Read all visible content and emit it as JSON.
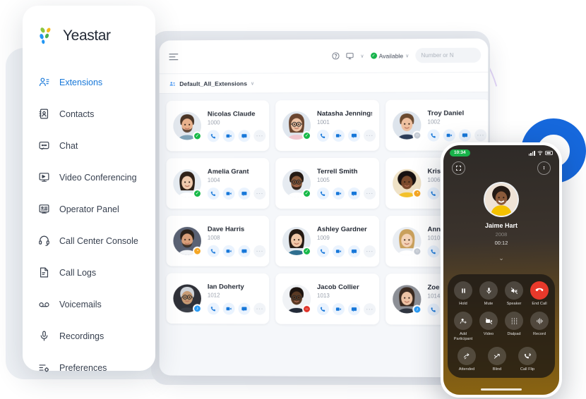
{
  "brand": {
    "name": "Yeastar",
    "accent": "#1677d9",
    "logo_icon": "yeastar-logo"
  },
  "sidebar": {
    "items": [
      {
        "label": "Extensions",
        "icon": "extensions-icon",
        "active": true
      },
      {
        "label": "Contacts",
        "icon": "contacts-icon",
        "active": false
      },
      {
        "label": "Chat",
        "icon": "chat-icon",
        "active": false
      },
      {
        "label": "Video Conferencing",
        "icon": "video-conferencing-icon",
        "active": false
      },
      {
        "label": "Operator Panel",
        "icon": "operator-panel-icon",
        "active": false
      },
      {
        "label": "Call Center Console",
        "icon": "headset-icon",
        "active": false
      },
      {
        "label": "Call Logs",
        "icon": "call-logs-icon",
        "active": false
      },
      {
        "label": "Voicemails",
        "icon": "voicemail-icon",
        "active": false
      },
      {
        "label": "Recordings",
        "icon": "microphone-icon",
        "active": false
      },
      {
        "label": "Preferences",
        "icon": "preferences-icon",
        "active": false
      }
    ]
  },
  "topbar": {
    "menu_icon": "hamburger-icon",
    "help_icon": "help-circle-icon",
    "device_icon": "desktop-icon",
    "device_caret": "∨",
    "status_label": "Available",
    "status_color": "#15b34a",
    "status_caret": "∨",
    "search_placeholder": "Number or N"
  },
  "subbar": {
    "group_icon": "group-icon",
    "group_label": "Default_All_Extensions",
    "caret": "∨"
  },
  "card_actions": {
    "call": "phone-icon",
    "video": "video-icon",
    "chat": "chat-icon",
    "more": "more-icon",
    "more_glyph": "···"
  },
  "contacts": [
    {
      "name": "Nicolas Claude",
      "ext": "1000",
      "status": "online",
      "avatar": "male-1"
    },
    {
      "name": "Natasha Jennings",
      "ext": "1001",
      "status": "online",
      "avatar": "female-1"
    },
    {
      "name": "Troy Daniel",
      "ext": "1002",
      "status": "offline",
      "avatar": "male-2"
    },
    {
      "name": "Amelia Grant",
      "ext": "1004",
      "status": "online",
      "avatar": "female-2"
    },
    {
      "name": "Terrell Smith",
      "ext": "1005",
      "status": "online",
      "avatar": "male-3"
    },
    {
      "name": "Kristin H",
      "ext": "1006",
      "status": "away",
      "avatar": "female-3"
    },
    {
      "name": "Dave Harris",
      "ext": "1008",
      "status": "away",
      "avatar": "male-4"
    },
    {
      "name": "Ashley Gardner",
      "ext": "1009",
      "status": "online",
      "avatar": "female-4"
    },
    {
      "name": "Anna Sir",
      "ext": "1010",
      "status": "offline",
      "avatar": "female-5"
    },
    {
      "name": "Ian Doherty",
      "ext": "1012",
      "status": "ringing",
      "avatar": "male-5"
    },
    {
      "name": "Jacob Collier",
      "ext": "1013",
      "status": "dnd",
      "avatar": "male-6"
    },
    {
      "name": "Zoe Evan",
      "ext": "1014",
      "status": "ringing",
      "avatar": "female-6"
    }
  ],
  "phone": {
    "time": "10:34",
    "signal_icon": "signal-bars-icon",
    "wifi_icon": "wifi-icon",
    "battery_icon": "battery-icon",
    "expand_icon": "expand-icon",
    "info_icon": "info-icon",
    "caller_name": "Jaime Hart",
    "caller_number": "2008",
    "duration": "00:12",
    "collapse_caret": "⌄",
    "controls": [
      {
        "label": "Hold",
        "icon": "pause-icon",
        "style": "normal"
      },
      {
        "label": "Mute",
        "icon": "microphone-icon",
        "style": "normal"
      },
      {
        "label": "Speaker",
        "icon": "speaker-off-icon",
        "style": "normal"
      },
      {
        "label": "End Call",
        "icon": "end-call-icon",
        "style": "end"
      },
      {
        "label": "Add Participant",
        "icon": "add-person-icon",
        "style": "normal"
      },
      {
        "label": "Video",
        "icon": "video-off-icon",
        "style": "normal"
      },
      {
        "label": "Dialpad",
        "icon": "dialpad-icon",
        "style": "normal"
      },
      {
        "label": "Record",
        "icon": "record-icon",
        "style": "normal"
      },
      {
        "label": "Attended",
        "icon": "attended-transfer-icon",
        "style": "normal"
      },
      {
        "label": "Blind",
        "icon": "blind-transfer-icon",
        "style": "normal"
      },
      {
        "label": "Call Flip",
        "icon": "call-flip-icon",
        "style": "normal"
      }
    ]
  }
}
